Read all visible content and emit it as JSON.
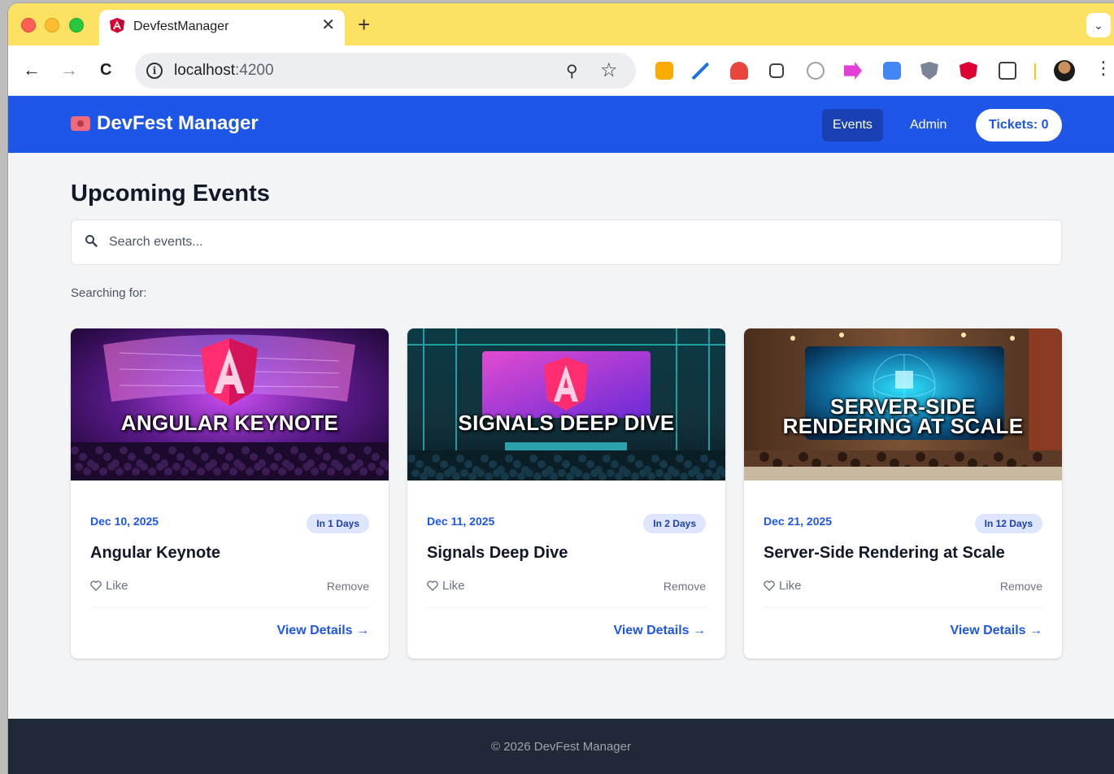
{
  "browser": {
    "tab_title": "DevfestManager",
    "tab_close": "✕",
    "new_tab": "+",
    "tab_menu": "⌄",
    "url_host": "localhost",
    "url_port": ":4200",
    "back": "←",
    "forward": "→",
    "reload": "C",
    "info": "i",
    "zoom": "⚲",
    "star": "☆",
    "kebab": "⋮",
    "extensions": [
      {
        "name": "keep-extension-icon",
        "color": "#f9ab00"
      },
      {
        "name": "pen-extension-icon",
        "color": "#1a73e8"
      },
      {
        "name": "network-extension-icon",
        "color": "#e8453c"
      },
      {
        "name": "z-extension-icon",
        "color": "#3c4043"
      },
      {
        "name": "target-extension-icon",
        "color": "#9aa0a6"
      },
      {
        "name": "arrow-extension-icon",
        "color": "#e53dd8"
      },
      {
        "name": "translate-extension-icon",
        "color": "#4285f4"
      },
      {
        "name": "shield-extension-icon",
        "color": "#7a8598"
      },
      {
        "name": "angular-extension-icon",
        "color": "#dd0031"
      },
      {
        "name": "puzzle-extension-icon",
        "color": "#3c4043"
      }
    ]
  },
  "header": {
    "brand": "DevFest Manager",
    "nav": [
      {
        "label": "Events",
        "active": true
      },
      {
        "label": "Admin",
        "active": false
      }
    ],
    "tickets_label": "Tickets: 0"
  },
  "main": {
    "title": "Upcoming Events",
    "search_placeholder": "Search events...",
    "search_value": "",
    "search_status": "Searching for:"
  },
  "events": [
    {
      "date": "Dec 10, 2025",
      "badge": "In 1 Days",
      "title": "Angular Keynote",
      "like": "Like",
      "remove": "Remove",
      "details": "View Details →",
      "image_text": [
        "ANGULAR KEYNOTE"
      ],
      "image_theme": "angular-stage"
    },
    {
      "date": "Dec 11, 2025",
      "badge": "In 2 Days",
      "title": "Signals Deep Dive",
      "like": "Like",
      "remove": "Remove",
      "details": "View Details →",
      "image_text": [
        "SIGNALS DEEP DIVE"
      ],
      "image_theme": "teal-stage"
    },
    {
      "date": "Dec 21, 2025",
      "badge": "In 12 Days",
      "title": "Server-Side Rendering at Scale",
      "like": "Like",
      "remove": "Remove",
      "details": "View Details →",
      "image_text": [
        "SERVER-SIDE",
        "RENDERING AT SCALE"
      ],
      "image_theme": "wood-room"
    }
  ],
  "footer": {
    "text": "© 2026 DevFest Manager"
  },
  "colors": {
    "primary": "#1e56e8",
    "primary_dark": "#1a41b4",
    "tabstrip": "#fde163",
    "footer": "#1f2937",
    "badge_bg": "#dde6fd"
  }
}
